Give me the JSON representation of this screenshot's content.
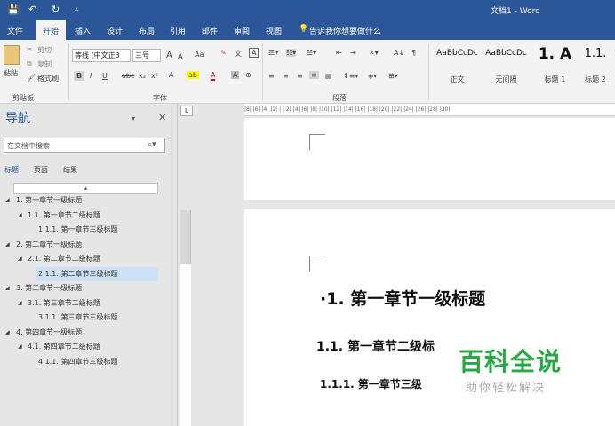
{
  "window": {
    "title": "文档1 - Word"
  },
  "quick_access": {
    "save_icon": "💾",
    "undo_icon": "↶",
    "redo_icon": "↻",
    "more_icon": "⩡"
  },
  "tabs": [
    "文件",
    "开始",
    "插入",
    "设计",
    "布局",
    "引用",
    "邮件",
    "审阅",
    "视图"
  ],
  "tell_me": "告诉我你想要做什么",
  "ribbon": {
    "clipboard": {
      "paste": "粘贴",
      "cut": "剪切",
      "copy": "复制",
      "format_painter": "格式刷",
      "label": "剪贴板"
    },
    "font": {
      "name": "等线 (中文正3",
      "size": "三号",
      "grow": "A",
      "shrink": "A",
      "case": "Aa",
      "bold": "B",
      "italic": "I",
      "underline": "U",
      "strike": "abc",
      "subscript": "x₂",
      "superscript": "x²",
      "label": "字体"
    },
    "paragraph": {
      "label": "段落"
    },
    "styles": [
      {
        "sample": "AaBbCcDc",
        "name": "正文"
      },
      {
        "sample": "AaBbCcDc",
        "name": "无间隔"
      },
      {
        "sample": "1.  A",
        "name": "标题 1"
      },
      {
        "sample": "1.1.",
        "name": "标题 2"
      }
    ]
  },
  "nav": {
    "title": "导航",
    "search_placeholder": "在文档中搜索",
    "tabs": [
      "标题",
      "页面",
      "结果"
    ],
    "collapse_glyph": "▴",
    "headings": [
      {
        "text": "1. 第一章节一级标题",
        "level": 1,
        "tri": "◢"
      },
      {
        "text": "1.1. 第一章节二级标题",
        "level": 2,
        "tri": "◢"
      },
      {
        "text": "1.1.1. 第一章节三级标题",
        "level": 3,
        "tri": ""
      },
      {
        "text": "2. 第二章节一级标题",
        "level": 1,
        "tri": "◢"
      },
      {
        "text": "2.1. 第二章节二级标题",
        "level": 2,
        "tri": "◢"
      },
      {
        "text": "2.1.1. 第二章节三级标题",
        "level": 3,
        "tri": ""
      },
      {
        "text": "3. 第三章节一级标题",
        "level": 1,
        "tri": "◢"
      },
      {
        "text": "3.1. 第三章节二级标题",
        "level": 2,
        "tri": "◢"
      },
      {
        "text": "3.1.1. 第三章节三级标题",
        "level": 3,
        "tri": ""
      },
      {
        "text": "4. 第四章节一级标题",
        "level": 1,
        "tri": "◢"
      },
      {
        "text": "4.1. 第四章节二级标题",
        "level": 2,
        "tri": "◢"
      },
      {
        "text": "4.1.1. 第四章节三级标题",
        "level": 3,
        "tri": ""
      }
    ],
    "selected_index": 5
  },
  "ruler": {
    "numbers": "|8| |6| |4| |2| |  | 2| |4| |6| |8| |10| |12| |14| |16| |18| |20| |22| |24| |26| |28| |30|"
  },
  "document": {
    "h1": "·1. 第一章节一级标题",
    "h2": "1.1. 第一章节二级标",
    "h3": "1.1.1. 第一章节三级"
  },
  "watermark": {
    "title": "百科全说",
    "subtitle": "助你轻松解决"
  }
}
